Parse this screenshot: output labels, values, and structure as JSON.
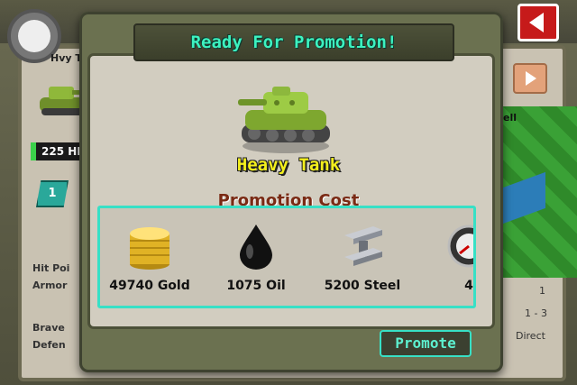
{
  "background": {
    "unit_name": "Hvy T",
    "hp": "225 HP",
    "rank": "1",
    "stats": [
      "Hit Poi",
      "Armor",
      "Brave",
      "Defen"
    ],
    "right_values": [
      "1",
      "1 - 3",
      "Direct"
    ],
    "map_label": "ell"
  },
  "modal": {
    "title": "Ready For Promotion!",
    "unit_name": "Heavy Tank",
    "cost_label": "Promotion Cost",
    "costs": [
      {
        "icon": "gold-coins-icon",
        "text": "49740 Gold"
      },
      {
        "icon": "oil-drop-icon",
        "text": "1075 Oil"
      },
      {
        "icon": "steel-beam-icon",
        "text": "5200 Steel"
      },
      {
        "icon": "gauge-icon",
        "text": "4"
      }
    ],
    "promote_label": "Promote"
  },
  "colors": {
    "title": "#3df2c0",
    "unit_name": "#f3ef1c",
    "cost_label": "#7a2a14",
    "accent_border": "#37e0c6"
  }
}
